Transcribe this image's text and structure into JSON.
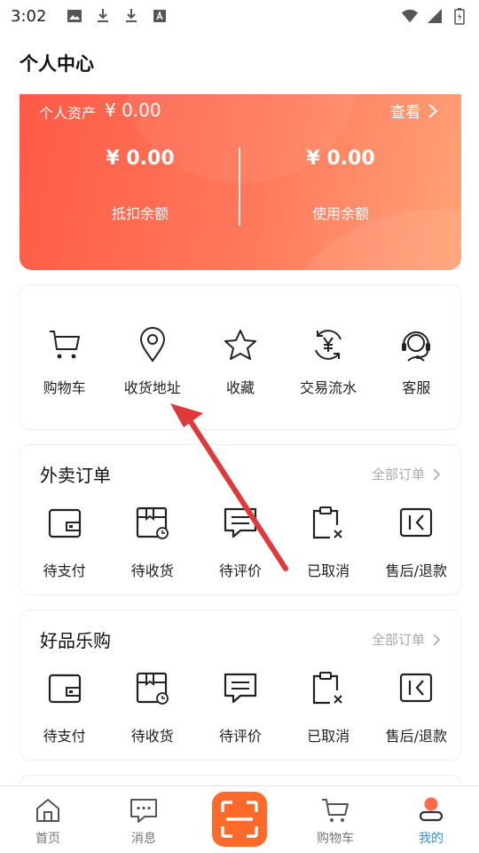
{
  "status_bar": {
    "time": "3:02"
  },
  "page": {
    "title": "个人中心"
  },
  "assets": {
    "label": "个人资产",
    "amount": "¥ 0.00",
    "view_label": "查看",
    "deduct": {
      "value": "¥ 0.00",
      "label": "抵扣余额"
    },
    "usage": {
      "value": "¥ 0.00",
      "label": "使用余额"
    }
  },
  "quick_actions": [
    {
      "label": "购物车",
      "icon": "cart-icon"
    },
    {
      "label": "收货地址",
      "icon": "location-pin-icon"
    },
    {
      "label": "收藏",
      "icon": "star-icon"
    },
    {
      "label": "交易流水",
      "icon": "yen-cycle-icon"
    },
    {
      "label": "客服",
      "icon": "headset-icon"
    }
  ],
  "takeout_orders": {
    "title": "外卖订单",
    "all_label": "全部订单",
    "items": [
      {
        "label": "待支付",
        "icon": "wallet-icon"
      },
      {
        "label": "待收货",
        "icon": "package-icon"
      },
      {
        "label": "待评价",
        "icon": "comment-icon"
      },
      {
        "label": "已取消",
        "icon": "clipboard-x-icon"
      },
      {
        "label": "售后/退款",
        "icon": "refund-icon"
      }
    ]
  },
  "goods_orders": {
    "title": "好品乐购",
    "all_label": "全部订单",
    "items": [
      {
        "label": "待支付",
        "icon": "wallet-icon"
      },
      {
        "label": "待收货",
        "icon": "package-icon"
      },
      {
        "label": "待评价",
        "icon": "comment-icon"
      },
      {
        "label": "已取消",
        "icon": "clipboard-x-icon"
      },
      {
        "label": "售后/退款",
        "icon": "refund-icon"
      }
    ]
  },
  "tab_bar": {
    "home": "首页",
    "messages": "消息",
    "cart": "购物车",
    "mine": "我的",
    "active": "mine"
  },
  "colors": {
    "card_gradient_start": "#ff5a46",
    "card_gradient_end": "#ffa277",
    "scan_button": "#ff6a2a",
    "active_tab": "#3d8fd6",
    "annotation_arrow": "#e0393c"
  }
}
